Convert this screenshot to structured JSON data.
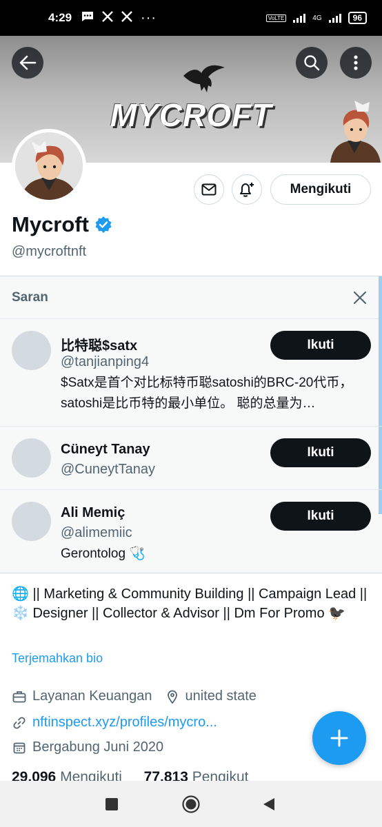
{
  "status_bar": {
    "time": "4:29",
    "icons": [
      "message-icon",
      "x-app-icon",
      "x-app-icon",
      "more-dots"
    ],
    "network_label": "4G",
    "volte_label": "VoLTE",
    "battery": "96"
  },
  "banner": {
    "title": "MYCROFT"
  },
  "profile": {
    "name": "Mycroft",
    "verified": true,
    "handle": "@mycroftnft",
    "follow_label": "Mengikuti"
  },
  "suggestions": {
    "header": "Saran",
    "items": [
      {
        "name": "比特聪$satx",
        "handle": "@tanjianping4",
        "bio": "$Satx是首个对比标特币聪satoshi的BRC-20代币，satoshi是比币特的最小单位。 聪的总量为…",
        "button": "Ikuti"
      },
      {
        "name": "Cüneyt Tanay",
        "handle": "@CuneytTanay",
        "bio": "",
        "button": "Ikuti"
      },
      {
        "name": "Ali Memiç",
        "handle": "@alimemiic",
        "bio": "Gerontolog 🩺",
        "button": "Ikuti"
      }
    ]
  },
  "bio": {
    "text": "🌐 || Marketing & Community Building || Campaign Lead || ❄️ Designer || Collector & Advisor || Dm For Promo 🐦‍⬛",
    "translate": "Terjemahkan bio"
  },
  "meta": {
    "category": "Layanan Keuangan",
    "location": "united state",
    "website": "nftinspect.xyz/profiles/mycro...",
    "joined": "Bergabung Juni 2020"
  },
  "counts": {
    "following_num": "29.096",
    "following_label": "Mengikuti",
    "followers_num": "77.813",
    "followers_label": "Pengikut"
  },
  "colors": {
    "accent": "#1d9bf0",
    "text": "#0f1419",
    "muted": "#536471"
  }
}
